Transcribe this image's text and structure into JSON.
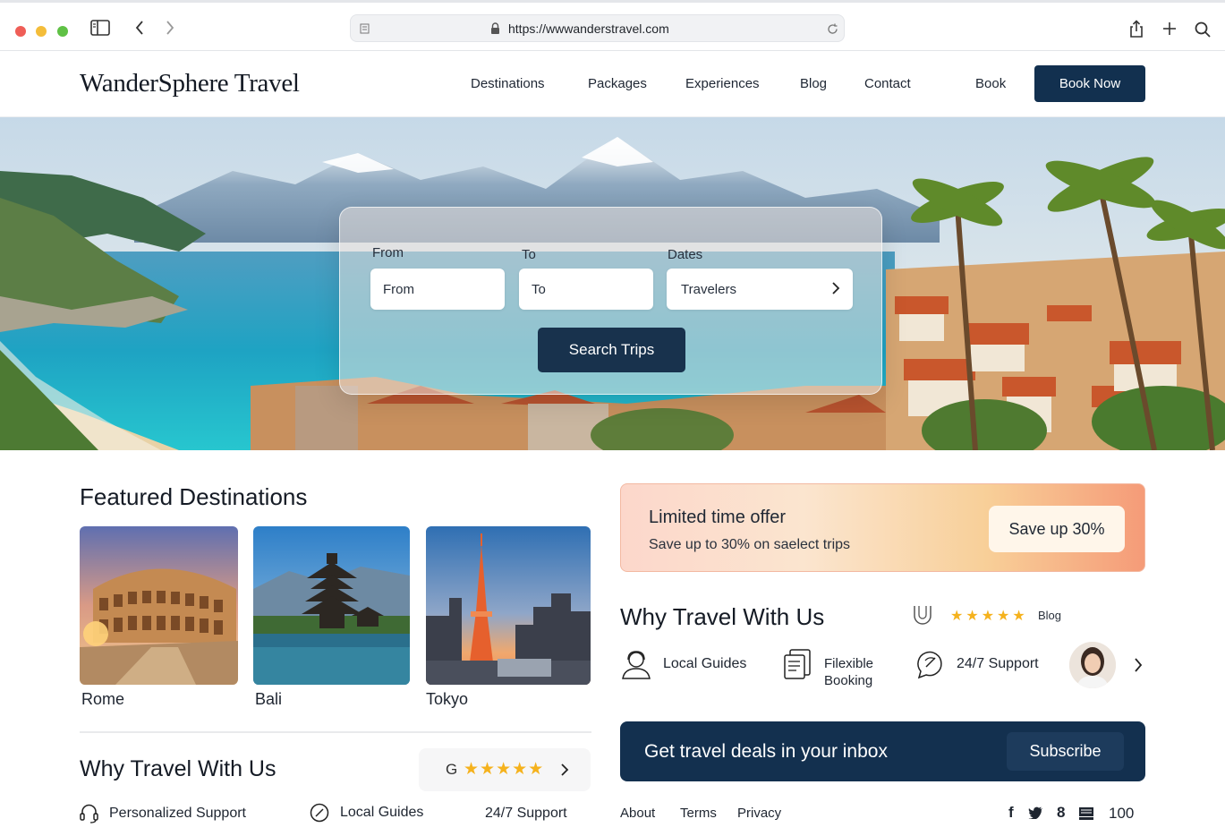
{
  "browser": {
    "url": "https://wwwanderstravel.com"
  },
  "site": {
    "logo": "WanderSphere Travel",
    "nav": [
      "Destinations",
      "Packages",
      "Experiences",
      "Blog",
      "Contact",
      "Book"
    ],
    "cta": "Book Now"
  },
  "search": {
    "labels": {
      "from": "From",
      "to": "To",
      "dates": "Dates"
    },
    "inputs": {
      "from": "From",
      "to": "To",
      "travelers": "Travelers"
    },
    "button": "Search Trips"
  },
  "featured": {
    "title": "Featured Destinations",
    "destinations": [
      "Rome",
      "Bali",
      "Tokyo"
    ]
  },
  "why_left": {
    "title": "Why Travel With Us",
    "rating_logo": "G",
    "features": [
      "Personalized Support",
      "Local Guides",
      "24/7 Support"
    ]
  },
  "offer": {
    "title": "Limited time offer",
    "subtitle": "Save up to 30% on saelect trips",
    "button": "Save up 30%"
  },
  "why_right": {
    "title": "Why Travel With Us",
    "rating_label": "Blog",
    "features": [
      "Local Guides",
      "Filexible Booking",
      "24/7 Support"
    ]
  },
  "newsletter": {
    "text": "Get travel deals in your inbox",
    "button": "Subscribe"
  },
  "footer": {
    "links": [
      "About",
      "Terms",
      "Privacy"
    ],
    "social_count": "100"
  },
  "colors": {
    "primary": "#12304f",
    "star": "#f5b21d",
    "offer_gradient_start": "#fcd7cb",
    "offer_gradient_end": "#f59b78"
  }
}
